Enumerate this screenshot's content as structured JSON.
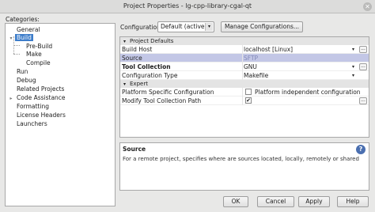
{
  "window": {
    "title": "Project Properties - lg-cpp-library-cgal-qt",
    "close_glyph": "✕"
  },
  "categories": {
    "label": "Categories:",
    "items": [
      {
        "label": "General",
        "toggle": ""
      },
      {
        "label": "Build",
        "toggle": "▾",
        "selected": true
      },
      {
        "label": "Pre-Build",
        "toggle": ""
      },
      {
        "label": "Make",
        "toggle": ""
      },
      {
        "label": "Compile",
        "toggle": ""
      },
      {
        "label": "Run",
        "toggle": ""
      },
      {
        "label": "Debug",
        "toggle": ""
      },
      {
        "label": "Related Projects",
        "toggle": ""
      },
      {
        "label": "Code Assistance",
        "toggle": "▸"
      },
      {
        "label": "Formatting",
        "toggle": ""
      },
      {
        "label": "License Headers",
        "toggle": ""
      },
      {
        "label": "Launchers",
        "toggle": ""
      }
    ]
  },
  "configuration": {
    "label": "Configuration:",
    "value": "Default (active)",
    "manage_label": "Manage Configurations..."
  },
  "sheet": {
    "project_defaults": "Project Defaults",
    "rows": [
      {
        "key": "Build Host",
        "value": "localhost [Linux]"
      },
      {
        "key": "Source",
        "value": "SFTP"
      },
      {
        "key": "Tool Collection",
        "value": "GNU"
      },
      {
        "key": "Configuration Type",
        "value": "Makefile"
      }
    ],
    "expert": "Expert",
    "expert_rows": [
      {
        "key": "Platform Specific Configuration",
        "value": "Platform independent configuration"
      },
      {
        "key": "Modify Tool Collection Path",
        "value": "✔"
      }
    ],
    "ellipsis": "...",
    "dropdown": "▾"
  },
  "description": {
    "title": "Source",
    "text": "For a remote project, specifies where are sources located, locally, remotely or shared",
    "help_glyph": "?"
  },
  "buttons": {
    "ok": "OK",
    "cancel": "Cancel",
    "apply": "Apply",
    "help": "Help"
  }
}
